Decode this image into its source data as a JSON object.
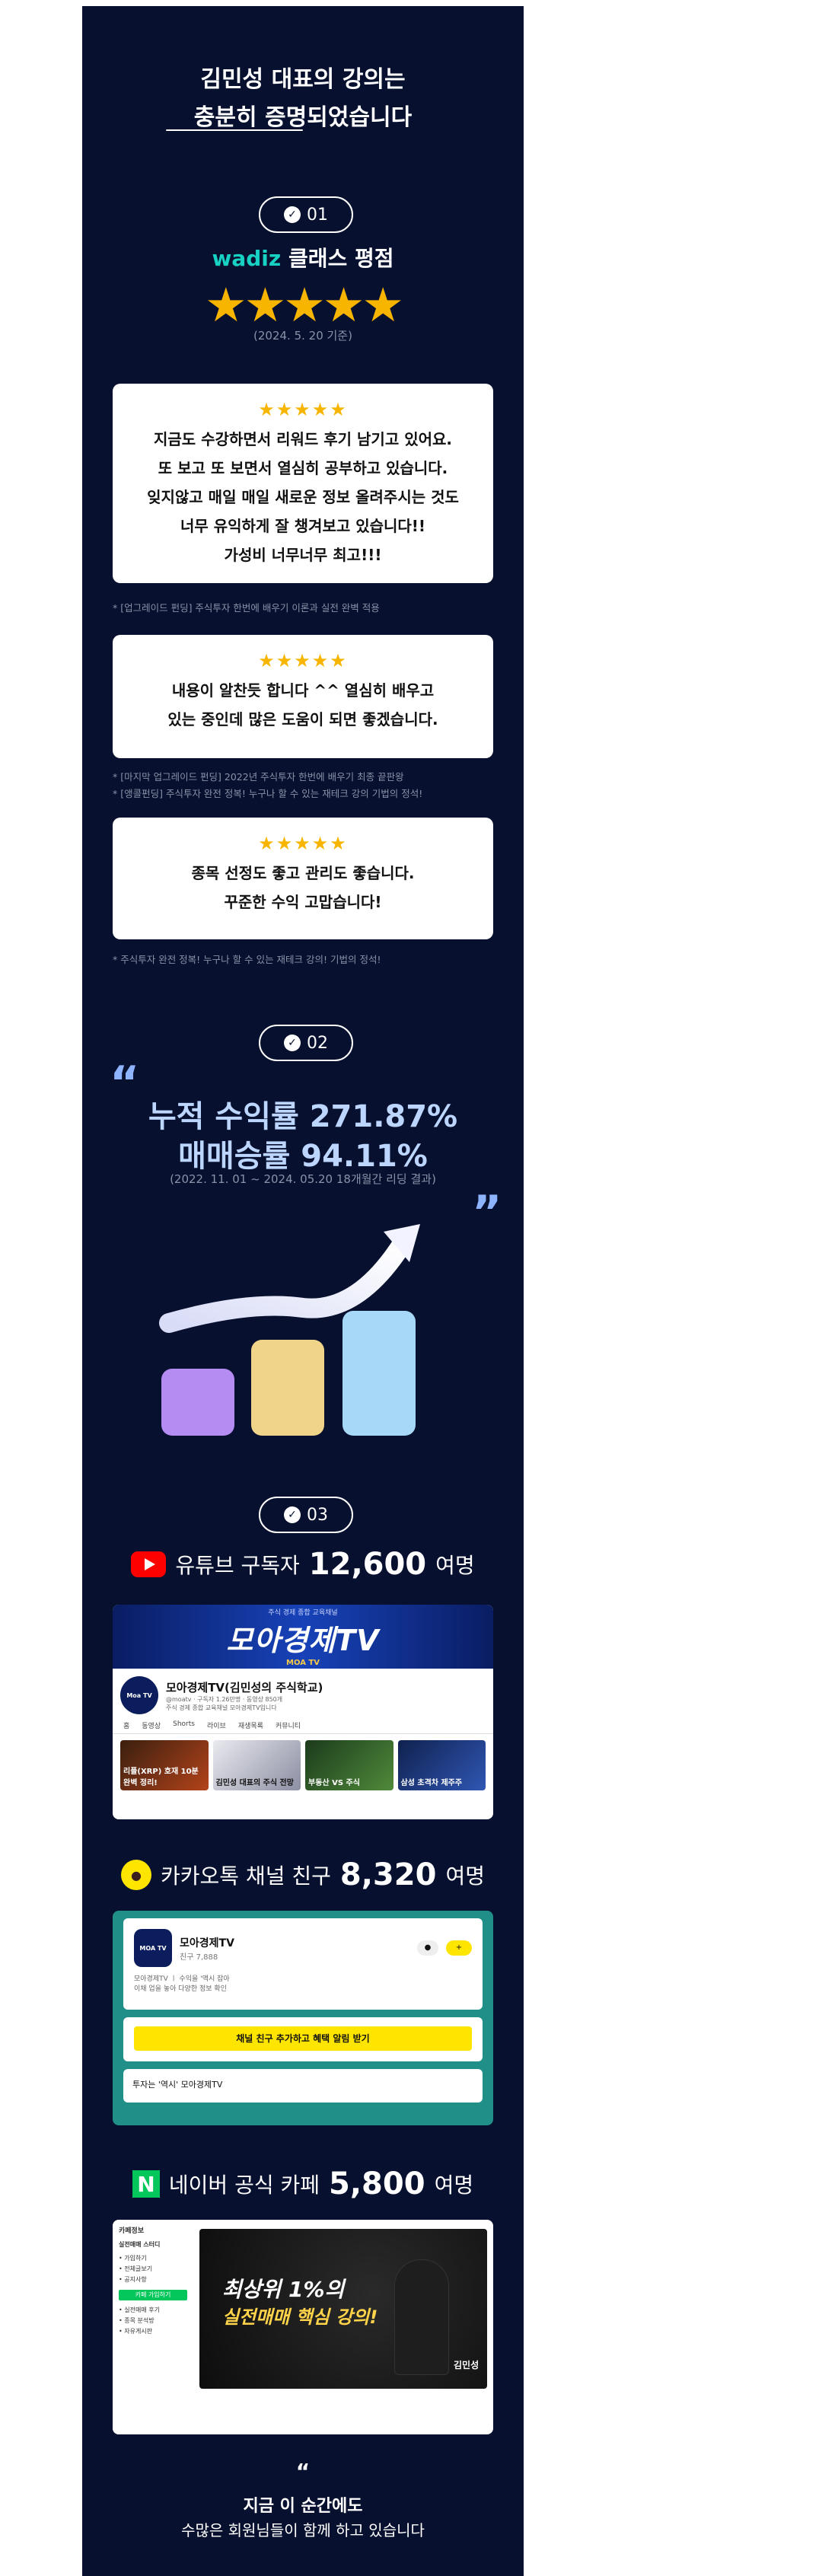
{
  "hero": {
    "line1": "김민성 대표의 강의는",
    "line2_bold": "충분히 증명",
    "line2_rest": "되었습니다"
  },
  "section1": {
    "badge": "01",
    "brand": "wadiz",
    "rating_label": "클래스 평점",
    "stars": "★★★★★",
    "date": "(2024. 5. 20 기준)"
  },
  "reviews": [
    {
      "stars": "★★★★★",
      "lines": [
        "지금도 수강하면서 리워드 후기 남기고 있어요.",
        "또 보고 또 보면서 열심히 공부하고 있습니다.",
        "잊지않고 매일 매일 새로운 정보 올려주시는 것도",
        "너무 유익하게 잘 챙겨보고 있습니다!!",
        "가성비 너무너무 최고!!!"
      ],
      "notes": [
        "* [업그레이드 펀딩] 주식투자 한번에 배우기 이론과 실전 완벽 적용"
      ]
    },
    {
      "stars": "★★★★★",
      "lines": [
        "내용이 알찬듯 합니다 ^^ 열심히 배우고",
        "있는 중인데 많은 도움이 되면 좋겠습니다."
      ],
      "notes": [
        "* [마지막 업그레이드 펀딩] 2022년 주식투자 한번에 배우기 최종 끝판왕",
        "* [앵콜펀딩] 주식투자 완전 정복! 누구나 할 수 있는 재테크 강의 기법의 정석!"
      ]
    },
    {
      "stars": "★★★★★",
      "lines": [
        "종목 선정도 좋고 관리도 좋습니다.",
        "꾸준한 수익 고맙습니다!"
      ],
      "notes": [
        "* 주식투자 완전 정복! 누구나 할 수 있는 재테크 강의! 기법의 정석!"
      ]
    }
  ],
  "section2": {
    "badge": "02",
    "open_quote": "“",
    "close_quote": "”",
    "stat1": "누적 수익률 271.87%",
    "stat2": "매매승률 94.11%",
    "period": "(2022. 11. 01 ~ 2024. 05.20 18개월간 리딩 결과)"
  },
  "bar_colors": [
    "#b58cf2",
    "#f0d48a",
    "#a8d8f8"
  ],
  "section3": {
    "badge": "03",
    "youtube": {
      "label": "유튜브 구독자",
      "count": "12,600",
      "unit": "여명"
    },
    "kakao": {
      "label": "카카오톡 채널 친구",
      "count": "8,320",
      "unit": "여명"
    },
    "naver": {
      "label": "네이버 공식 카페",
      "count": "5,800",
      "unit": "여명"
    }
  },
  "yt_shot": {
    "banner_sub": "주식 경제 종합 교육채널",
    "banner_title": "모아경제TV",
    "banner_moa": "MOA TV",
    "avatar": "Moa TV",
    "channel_name": "모아경제TV(김민성의 주식학교)",
    "meta1": "@moatv · 구독자 1.26만명 · 동영상 850개",
    "meta2": "주식 경제 종합 교육채널 모아경제TV입니다",
    "tabs": [
      "홈",
      "동영상",
      "Shorts",
      "라이브",
      "재생목록",
      "커뮤니티"
    ],
    "thumbs": [
      "리플(XRP) 호재 10분 완벽 정리!",
      "김민성 대표의 주식 전망",
      "부동산 VS 주식",
      "삼성 초격차 제주주"
    ]
  },
  "kk_shot": {
    "logo": "MOA TV",
    "name": "모아경제TV",
    "friends": "친구 7,888",
    "desc1": "모아경제TV 〡 수익을 '액시 잡아",
    "desc2": "이채 업을 놓아 다양한 정보 확인",
    "button": "채널 친구 추가하고 혜택 알림 받기",
    "post": "투자는 '역시' 모아경제TV"
  },
  "nv_shot": {
    "side_title": "카페정보",
    "side_name": "실전매매 스터디",
    "side_items": [
      "• 가입하기",
      "• 전체글보기",
      "• 공지사항",
      "• 실전매매 후기",
      "• 종목 분석방",
      "• 자유게시판"
    ],
    "join_button": "카페 가입하기",
    "headline1": "최상위 1%의",
    "headline2": "실전매매 핵심 강의!",
    "author": "김민성"
  },
  "footer": {
    "quote": "“",
    "line1": "지금 이 순간에도",
    "line2": "수많은 회원님들이 함께 하고 있습니다"
  }
}
